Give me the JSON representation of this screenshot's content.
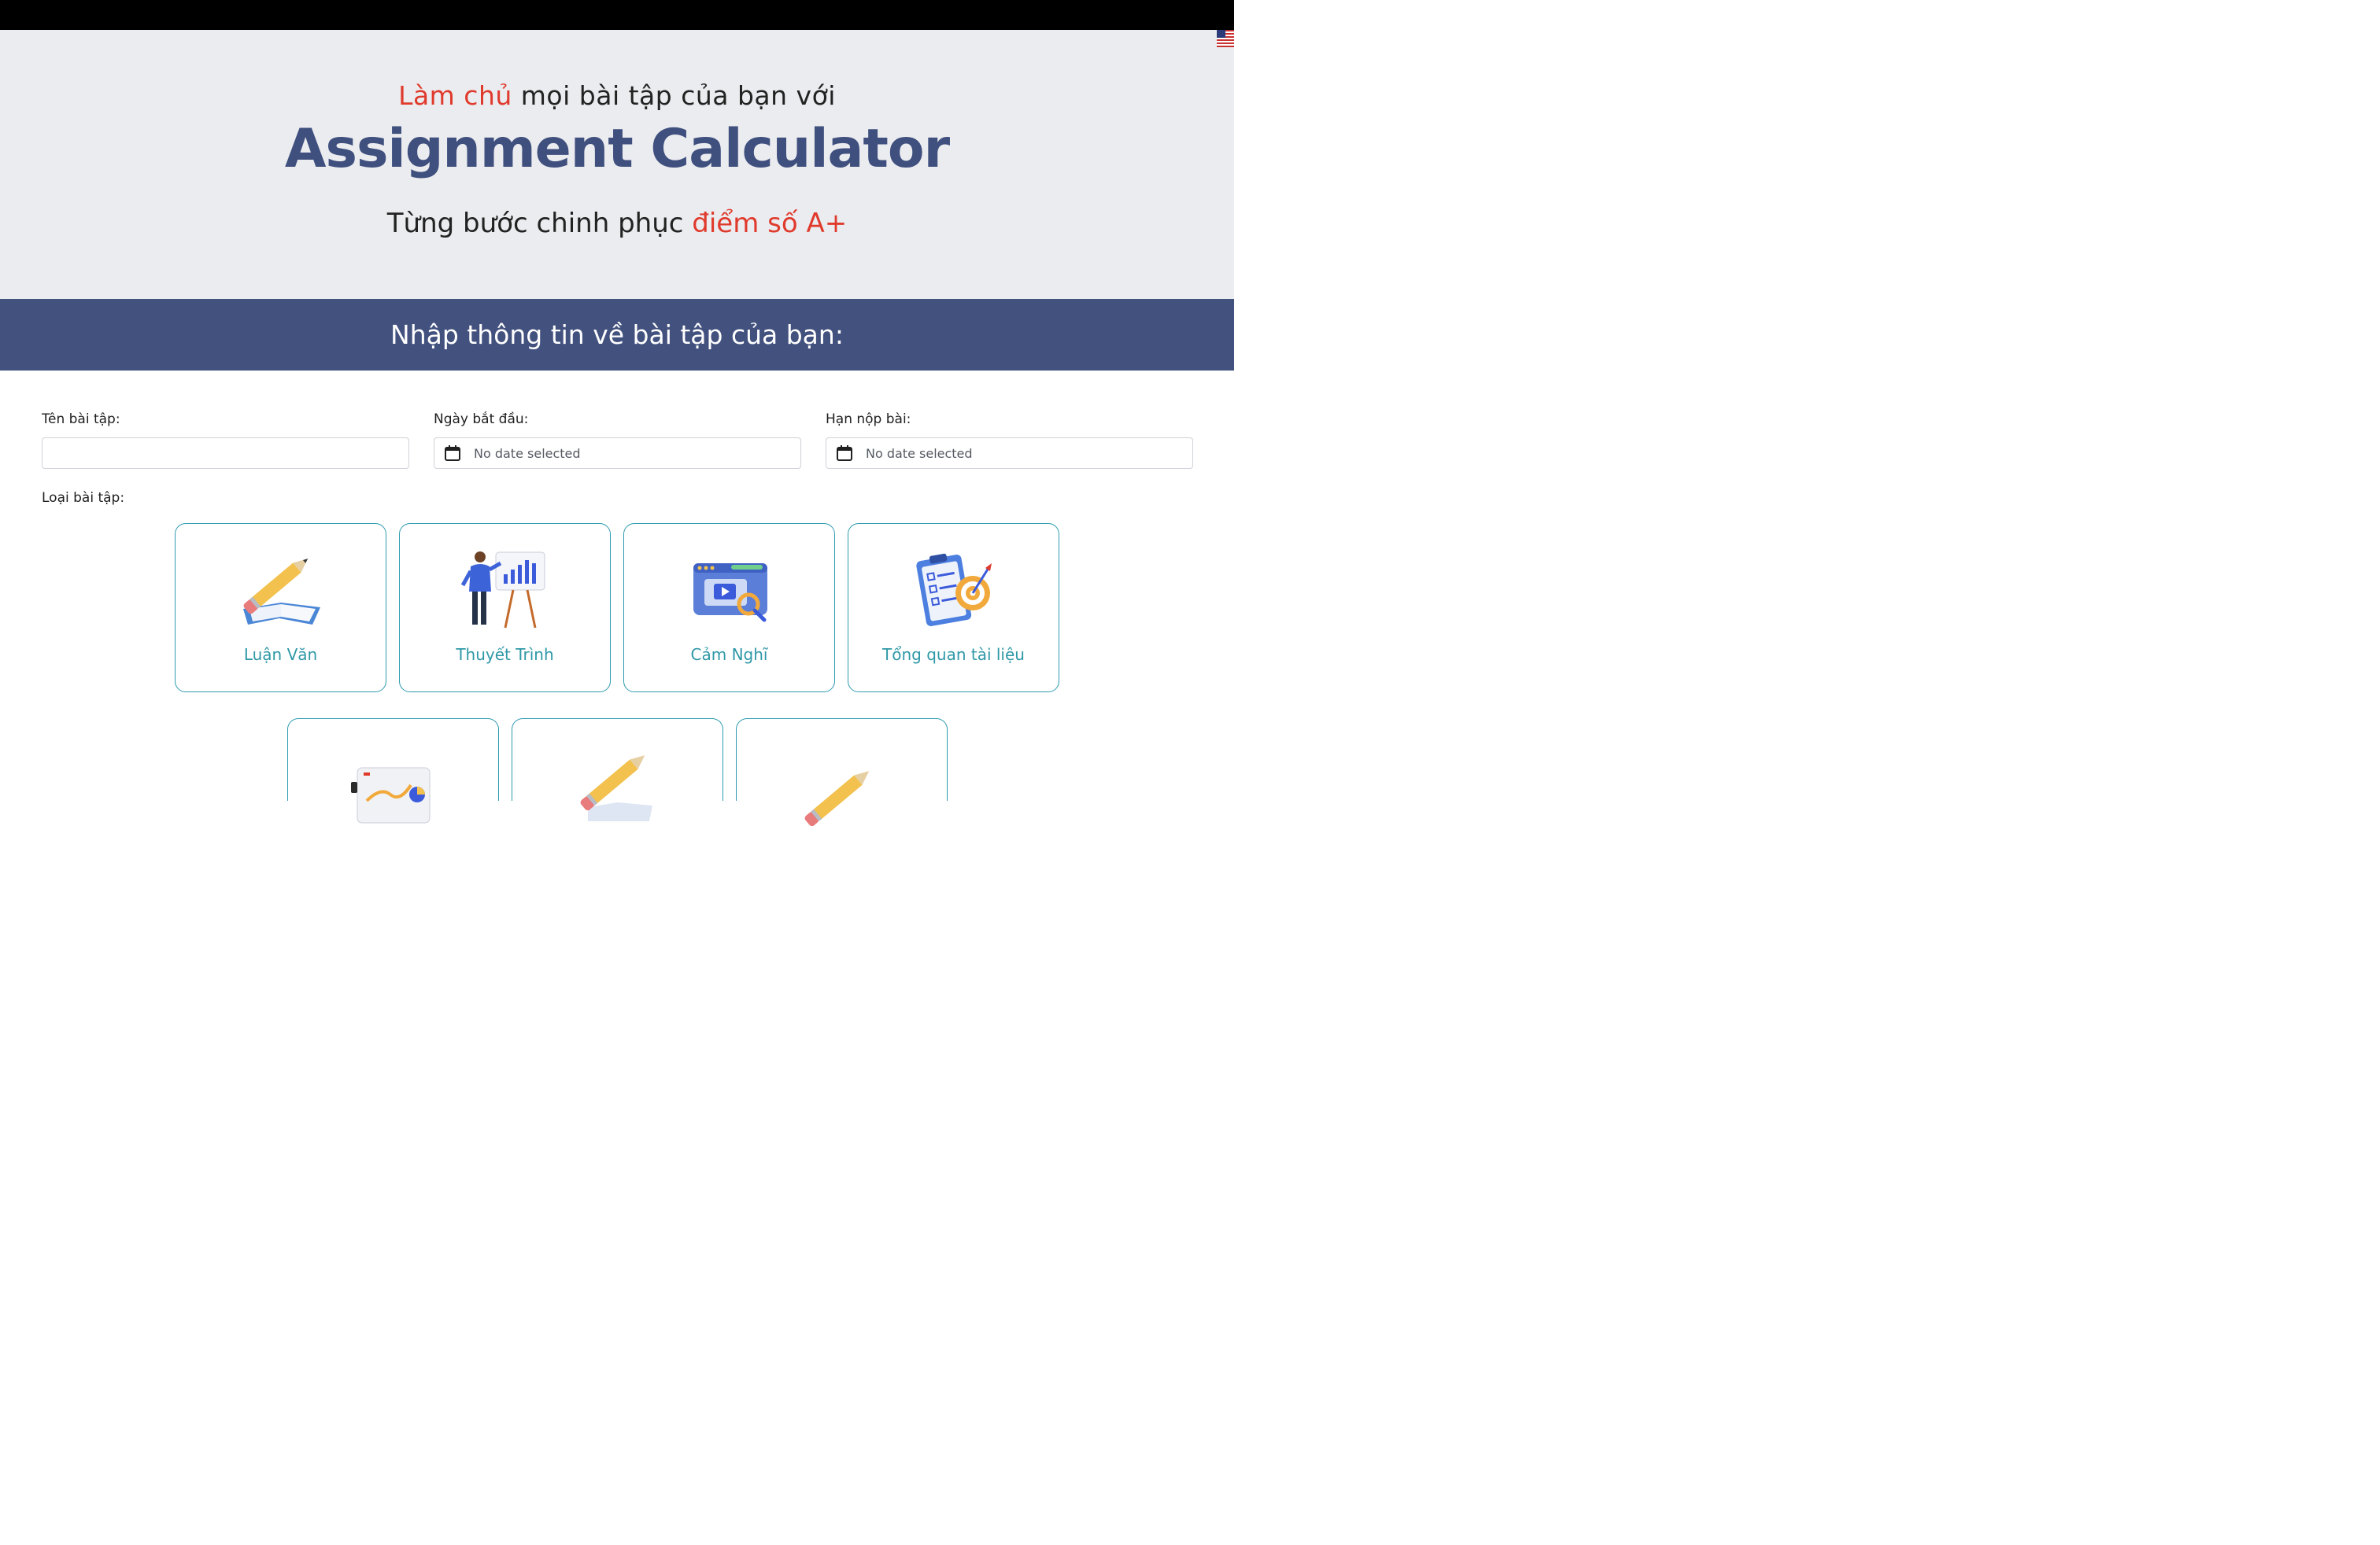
{
  "hero": {
    "tagline_accent": "Làm chủ",
    "tagline_rest": "mọi bài tập của bạn với",
    "title": "Assignment Calculator",
    "subtitle_start": "Từng bước chinh phục",
    "subtitle_accent": "điểm số A+",
    "language_flag": "us-flag-icon"
  },
  "section": {
    "heading": "Nhập thông tin về bài tập của bạn:"
  },
  "form": {
    "assignment_name": {
      "label": "Tên bài tập:",
      "value": ""
    },
    "start_date": {
      "label": "Ngày bắt đầu:",
      "placeholder": "No date selected"
    },
    "due_date": {
      "label": "Hạn nộp bài:",
      "placeholder": "No date selected"
    },
    "assignment_type_label": "Loại bài tập:"
  },
  "assignment_types": [
    {
      "label": "Luận Văn",
      "icon": "pencil-book-icon"
    },
    {
      "label": "Thuyết Trình",
      "icon": "presenter-chart-icon"
    },
    {
      "label": "Cảm Nghĩ",
      "icon": "video-search-icon"
    },
    {
      "label": "Tổng quan tài liệu",
      "icon": "checklist-target-icon"
    },
    {
      "label": "",
      "icon": "analytics-report-icon"
    },
    {
      "label": "",
      "icon": "pencil-book-icon"
    },
    {
      "label": "",
      "icon": "pencil-icon"
    }
  ],
  "colors": {
    "accent_red": "#e03a2c",
    "navy": "#42517e",
    "teal": "#2e9bb0",
    "hero_bg": "#ebecef"
  }
}
